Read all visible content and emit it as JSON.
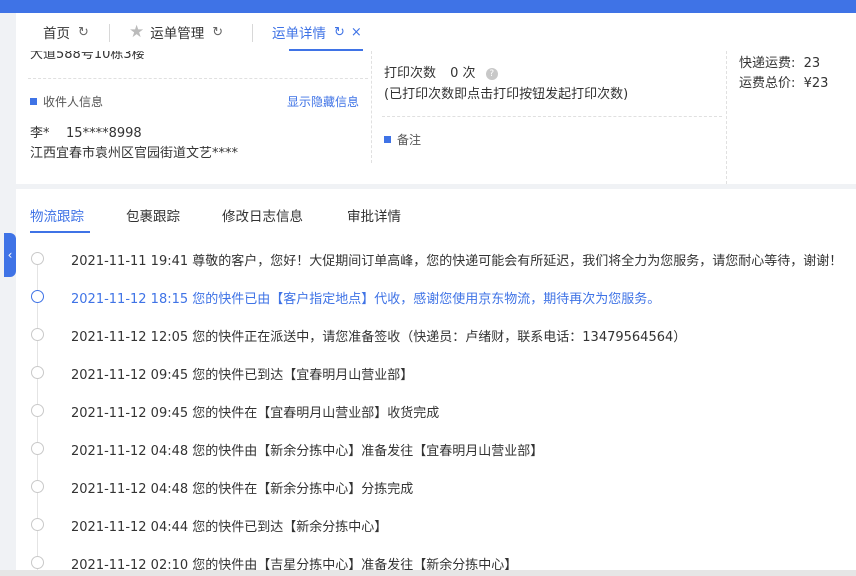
{
  "tabs": {
    "home": "首页",
    "waybill_mgmt": "运单管理",
    "waybill_detail": "运单详情"
  },
  "sender": {
    "address_cut": "大道588号10栋3楼"
  },
  "receiver": {
    "section_title": "收件人信息",
    "show_hidden": "显示隐藏信息",
    "name_phone": "李*    15****8998",
    "address": "江西宜春市袁州区官园街道文艺****"
  },
  "print": {
    "label": "打印次数",
    "count": "0 次",
    "help_icon": "?",
    "note": "(已打印次数即点击打印按钮发起打印次数)",
    "remark_title": "备注"
  },
  "fees": {
    "express_fee": "快递运费:  23",
    "total_fee": "运费总价:  ¥23"
  },
  "content_tabs": [
    "物流跟踪",
    "包裹跟踪",
    "修改日志信息",
    "审批详情"
  ],
  "timeline": [
    {
      "text": "2021-11-11 19:41 尊敬的客户，您好！大促期间订单高峰，您的快递可能会有所延迟，我们将全力为您服务，请您耐心等待，谢谢！",
      "active": false
    },
    {
      "text": "2021-11-12 18:15 您的快件已由【客户指定地点】代收，感谢您使用京东物流，期待再次为您服务。",
      "active": true
    },
    {
      "text": "2021-11-12 12:05 您的快件正在派送中，请您准备签收（快递员：卢绪财，联系电话：13479564564）",
      "active": false
    },
    {
      "text": "2021-11-12 09:45 您的快件已到达【宜春明月山营业部】",
      "active": false
    },
    {
      "text": "2021-11-12 09:45 您的快件在【宜春明月山营业部】收货完成",
      "active": false
    },
    {
      "text": "2021-11-12 04:48 您的快件由【新余分拣中心】准备发往【宜春明月山营业部】",
      "active": false
    },
    {
      "text": "2021-11-12 04:48 您的快件在【新余分拣中心】分拣完成",
      "active": false
    },
    {
      "text": "2021-11-12 04:44 您的快件已到达【新余分拣中心】",
      "active": false
    },
    {
      "text": "2021-11-12 02:10 您的快件由【吉星分拣中心】准备发往【新余分拣中心】",
      "active": false
    }
  ],
  "colors": {
    "accent": "#3f73e6",
    "text": "#333333"
  }
}
